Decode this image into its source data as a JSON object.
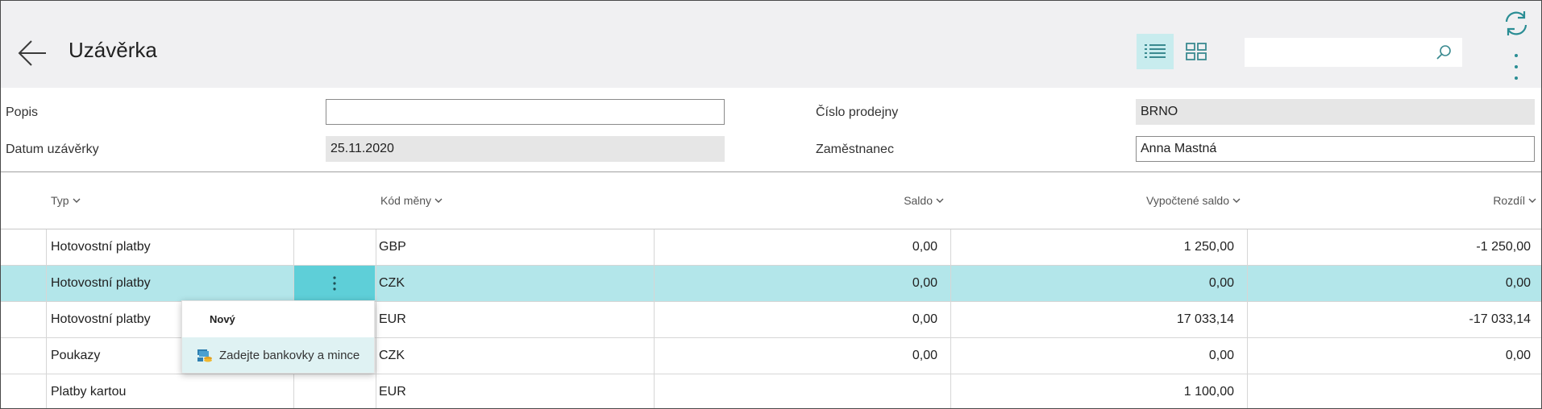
{
  "page": {
    "title": "Uzávěrka"
  },
  "header": {
    "back_icon": "back-arrow-icon",
    "list_view_icon": "list-view-icon",
    "tile_view_icon": "tile-view-icon",
    "search_value": "",
    "search_icon": "search-icon",
    "refresh_icon": "refresh-icon",
    "more_icon": "more-vertical-icon",
    "accent_color": "#008489"
  },
  "form": {
    "popis_label": "Popis",
    "popis_value": "",
    "datum_label": "Datum uzávěrky",
    "datum_value": "25.11.2020",
    "cislo_label": "Číslo prodejny",
    "cislo_value": "BRNO",
    "zamestnanec_label": "Zaměstnanec",
    "zamestnanec_value": "Anna Mastná"
  },
  "table": {
    "headers": {
      "typ": "Typ",
      "kod_meny": "Kód měny",
      "saldo": "Saldo",
      "vypoctene_saldo": "Vypočtené saldo",
      "rozdil": "Rozdíl"
    },
    "rows": [
      {
        "typ": "Hotovostní platby",
        "kod_meny": "GBP",
        "saldo": "0,00",
        "vypoctene_saldo": "1 250,00",
        "rozdil": "-1 250,00"
      },
      {
        "typ": "Hotovostní platby",
        "kod_meny": "CZK",
        "saldo": "0,00",
        "vypoctene_saldo": "0,00",
        "rozdil": "0,00"
      },
      {
        "typ": "Hotovostní platby",
        "kod_meny": "EUR",
        "saldo": "0,00",
        "vypoctene_saldo": "17 033,14",
        "rozdil": "-17 033,14"
      },
      {
        "typ": "Poukazy",
        "kod_meny": "CZK",
        "saldo": "0,00",
        "vypoctene_saldo": "0,00",
        "rozdil": "0,00"
      },
      {
        "typ": "Platby kartou",
        "kod_meny": "EUR",
        "saldo": "",
        "vypoctene_saldo": "1 100,00",
        "rozdil": ""
      }
    ],
    "selected_row_color": "#b3e6ea"
  },
  "context_menu": {
    "new_label": "Nový",
    "enter_label": "Zadejte bankovky a mince",
    "enter_icon": "cash-coins-icon"
  }
}
